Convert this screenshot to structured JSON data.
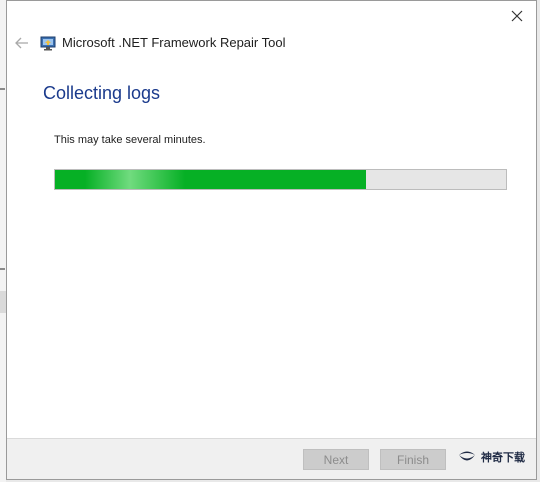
{
  "window": {
    "title": "Microsoft .NET Framework Repair Tool"
  },
  "page": {
    "heading": "Collecting logs",
    "subtitle": "This may take several minutes."
  },
  "progress": {
    "value_percent": 69,
    "fill_color": "#06b025"
  },
  "footer": {
    "next_label": "Next",
    "finish_label": "Finish"
  },
  "watermark": {
    "text": "神奇下载"
  },
  "icons": {
    "close": "close-icon",
    "back": "back-arrow-icon",
    "app": "net-repair-tool-icon",
    "watermark_logo": "site-logo"
  },
  "colors": {
    "heading": "#1a3a8c",
    "progress": "#06b025"
  }
}
